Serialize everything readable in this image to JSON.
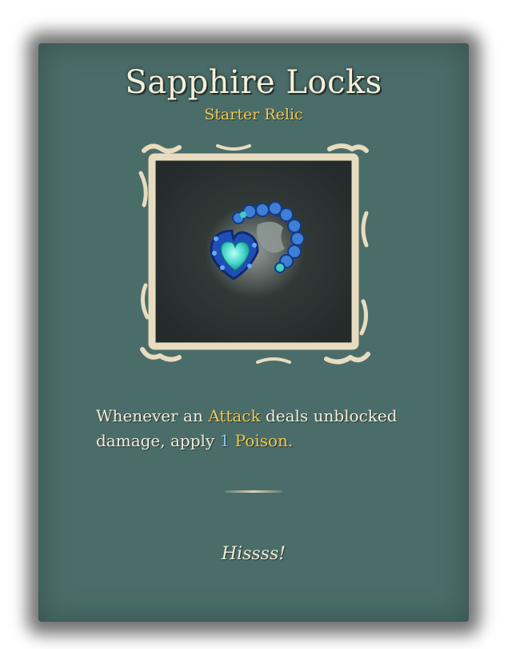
{
  "relic": {
    "name": "Sapphire Locks",
    "rarity": "Starter Relic",
    "icon": "sapphire-heart-locket-icon",
    "description": {
      "part1": "Whenever an ",
      "keyword_attack": "Attack",
      "part2": " deals unblocked damage, apply ",
      "amount": "1",
      "space": " ",
      "keyword_poison": "Poison."
    },
    "flavor": "Hissss!"
  },
  "colors": {
    "card_bg": "#4b6d69",
    "title": "#f5efd9",
    "keyword_gold": "#efc955",
    "number_blue": "#8cc6ef",
    "frame": "#e8dcc0"
  }
}
